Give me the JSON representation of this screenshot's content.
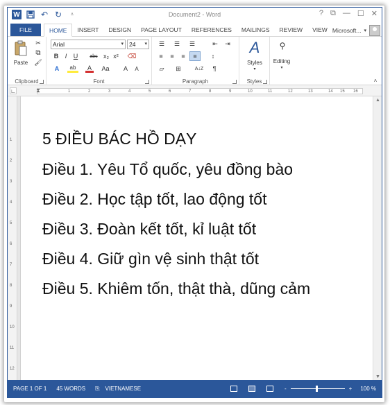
{
  "window": {
    "title": "Document2 - Word",
    "controls": [
      "?",
      "⧉",
      "—",
      "☐",
      "✕"
    ]
  },
  "qat": {
    "logo": "W",
    "icons": [
      "save-icon",
      "undo-icon",
      "redo-icon",
      "customize-qat-icon"
    ]
  },
  "ribbon_tabs": {
    "file": "FILE",
    "home": "HOME",
    "insert": "INSERT",
    "design": "DESIGN",
    "page_layout": "PAGE LAYOUT",
    "references": "REFERENCES",
    "mailings": "MAILINGS",
    "review": "REVIEW",
    "view": "VIEW",
    "account": "Microsoft..."
  },
  "ribbon": {
    "clipboard": {
      "label": "Clipboard",
      "paste": "Paste"
    },
    "font": {
      "label": "Font",
      "font_name": "Arial",
      "font_size": "24",
      "bold": "B",
      "italic": "I",
      "underline": "U",
      "strikethrough": "abc",
      "subscript": "x₂",
      "superscript": "x²",
      "change_case": "Aa",
      "grow": "A",
      "shrink": "A",
      "font_color": "A",
      "highlight": "ab"
    },
    "paragraph": {
      "label": "Paragraph",
      "pilcrow": "¶",
      "sort": "A↓Z"
    },
    "styles": {
      "label": "Styles",
      "button": "Styles"
    },
    "editing": {
      "label": "",
      "button": "Editing"
    }
  },
  "ruler": {
    "ticks": [
      "1",
      "2",
      "3",
      "4",
      "5",
      "6",
      "7",
      "8",
      "9",
      "10",
      "11",
      "12",
      "13",
      "14",
      "15",
      "16"
    ],
    "vticks": [
      "1",
      "2",
      "3",
      "4",
      "5",
      "6",
      "7",
      "8",
      "9",
      "10",
      "11",
      "12"
    ]
  },
  "document": {
    "lines": [
      "5 ĐIỀU BÁC HỒ DẠY",
      "Điều 1. Yêu Tổ quốc, yêu đồng bào",
      "Điều 2. Học tập tốt, lao động tốt",
      "Điều 3. Đoàn kết tốt, kỉ luật tốt",
      "Điều 4. Giữ gìn vệ sinh thật tốt",
      "Điều 5. Khiêm tốn, thật thà, dũng cảm"
    ]
  },
  "status": {
    "page": "PAGE 1 OF 1",
    "words": "45 WORDS",
    "language": "VIETNAMESE",
    "zoom_minus": "-",
    "zoom_plus": "+",
    "zoom": "100 %"
  },
  "colors": {
    "accent": "#2b579a"
  }
}
